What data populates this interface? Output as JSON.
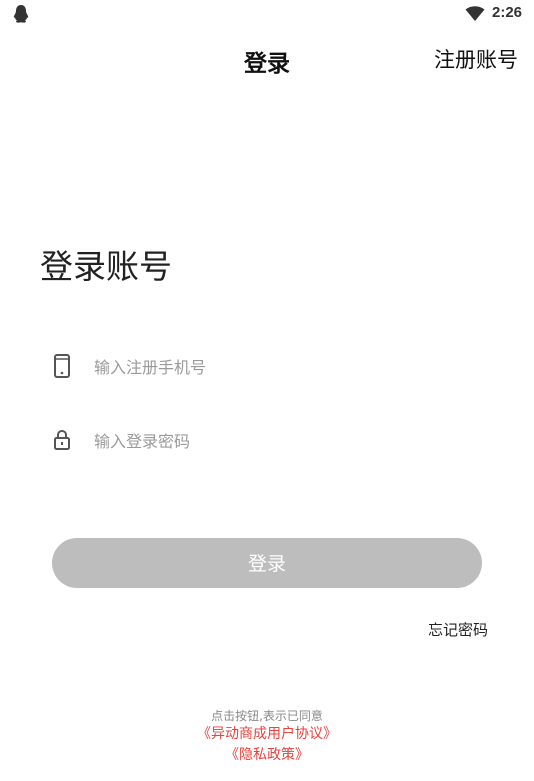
{
  "status_bar": {
    "time": "2:26",
    "left_icon": "qq-penguin-icon",
    "signal_icon": "wifi-icon"
  },
  "header": {
    "title": "登录",
    "register_label": "注册账号"
  },
  "main": {
    "heading": "登录账号",
    "phone_field": {
      "icon": "phone-icon",
      "placeholder": "输入注册手机号",
      "value": ""
    },
    "password_field": {
      "icon": "lock-icon",
      "placeholder": "输入登录密码",
      "value": ""
    },
    "login_button_label": "登录",
    "forgot_password_label": "忘记密码"
  },
  "footer": {
    "agree_text": "点击按钮,表示已同意",
    "user_agreement_label": "《异动商成用户协议》",
    "privacy_policy_label": "《隐私政策》"
  },
  "colors": {
    "button_disabled": "#bdbdbd",
    "link_accent": "#e8433f",
    "placeholder": "#9a9a9a"
  }
}
